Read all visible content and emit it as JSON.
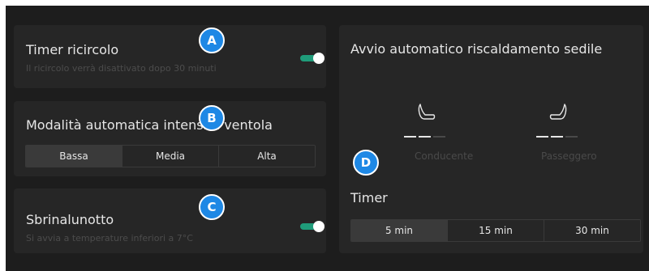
{
  "recirc": {
    "title": "Timer ricircolo",
    "subtitle": "Il ricircolo verrà disattivato dopo 30 minuti",
    "toggle_on": true
  },
  "fan": {
    "title": "Modalità automatica intensità ventola",
    "options": [
      "Bassa",
      "Media",
      "Alta"
    ],
    "selected": "Bassa"
  },
  "defrost": {
    "title": "Sbrinalunotto",
    "subtitle": "Si avvia a temperature inferiori a 7°C",
    "toggle_on": true
  },
  "seat": {
    "title": "Avvio automatico riscaldamento sedile",
    "driver_label": "Conducente",
    "passenger_label": "Passeggero",
    "driver_level": 2,
    "passenger_level": 2,
    "level_max": 3,
    "timer_title": "Timer",
    "timer_options": [
      "5 min",
      "15 min",
      "30 min"
    ],
    "timer_selected": "5 min"
  },
  "badges": {
    "a": "A",
    "b": "B",
    "c": "C",
    "d": "D"
  },
  "colors": {
    "accent": "#1f9c7a",
    "badge": "#1e88e5"
  }
}
